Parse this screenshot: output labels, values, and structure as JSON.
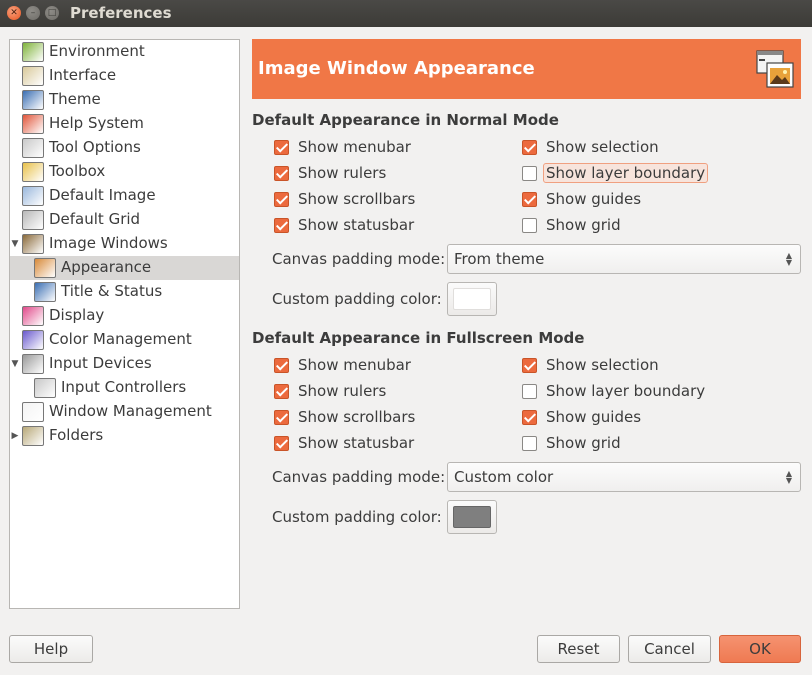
{
  "window": {
    "title": "Preferences"
  },
  "sidebar": {
    "items": [
      {
        "label": "Environment",
        "icon": "environment-icon",
        "level": 0,
        "expander": ""
      },
      {
        "label": "Interface",
        "icon": "interface-icon",
        "level": 0,
        "expander": ""
      },
      {
        "label": "Theme",
        "icon": "theme-icon",
        "level": 0,
        "expander": ""
      },
      {
        "label": "Help System",
        "icon": "help-system-icon",
        "level": 0,
        "expander": ""
      },
      {
        "label": "Tool Options",
        "icon": "tool-options-icon",
        "level": 0,
        "expander": ""
      },
      {
        "label": "Toolbox",
        "icon": "toolbox-icon",
        "level": 0,
        "expander": ""
      },
      {
        "label": "Default Image",
        "icon": "default-image-icon",
        "level": 0,
        "expander": ""
      },
      {
        "label": "Default Grid",
        "icon": "default-grid-icon",
        "level": 0,
        "expander": ""
      },
      {
        "label": "Image Windows",
        "icon": "image-windows-icon",
        "level": 0,
        "expander": "expanded"
      },
      {
        "label": "Appearance",
        "icon": "appearance-icon",
        "level": 1,
        "expander": "",
        "selected": true
      },
      {
        "label": "Title & Status",
        "icon": "title-status-icon",
        "level": 1,
        "expander": ""
      },
      {
        "label": "Display",
        "icon": "display-icon",
        "level": 0,
        "expander": ""
      },
      {
        "label": "Color Management",
        "icon": "color-management-icon",
        "level": 0,
        "expander": ""
      },
      {
        "label": "Input Devices",
        "icon": "input-devices-icon",
        "level": 0,
        "expander": "expanded"
      },
      {
        "label": "Input Controllers",
        "icon": "input-controllers-icon",
        "level": 1,
        "expander": ""
      },
      {
        "label": "Window Management",
        "icon": "window-management-icon",
        "level": 0,
        "expander": ""
      },
      {
        "label": "Folders",
        "icon": "folders-icon",
        "level": 0,
        "expander": "collapsed"
      }
    ]
  },
  "header": {
    "title": "Image Window Appearance",
    "icon": "image-window-appearance-icon"
  },
  "normal": {
    "title": "Default Appearance in Normal Mode",
    "left": [
      {
        "label": "Show menubar",
        "checked": true
      },
      {
        "label": "Show rulers",
        "checked": true
      },
      {
        "label": "Show scrollbars",
        "checked": true
      },
      {
        "label": "Show statusbar",
        "checked": true
      }
    ],
    "right": [
      {
        "label": "Show selection",
        "checked": true
      },
      {
        "label": "Show layer boundary",
        "checked": false,
        "focused": true
      },
      {
        "label": "Show guides",
        "checked": true
      },
      {
        "label": "Show grid",
        "checked": false
      }
    ],
    "padding_mode_label": "Canvas padding mode:",
    "padding_mode_value": "From theme",
    "padding_color_label": "Custom padding color:",
    "padding_color": "#ffffff"
  },
  "fullscreen": {
    "title": "Default Appearance in Fullscreen Mode",
    "left": [
      {
        "label": "Show menubar",
        "checked": true
      },
      {
        "label": "Show rulers",
        "checked": true
      },
      {
        "label": "Show scrollbars",
        "checked": true
      },
      {
        "label": "Show statusbar",
        "checked": true
      }
    ],
    "right": [
      {
        "label": "Show selection",
        "checked": true
      },
      {
        "label": "Show layer boundary",
        "checked": false
      },
      {
        "label": "Show guides",
        "checked": true
      },
      {
        "label": "Show grid",
        "checked": false
      }
    ],
    "padding_mode_label": "Canvas padding mode:",
    "padding_mode_value": "Custom color",
    "padding_color_label": "Custom padding color:",
    "padding_color": "#7f7f7f"
  },
  "buttons": {
    "help": "Help",
    "reset": "Reset",
    "cancel": "Cancel",
    "ok": "OK"
  },
  "colors": {
    "accent": "#f07746",
    "checkbox": "#ec6a3e",
    "titlebar": "#3c3b37"
  }
}
